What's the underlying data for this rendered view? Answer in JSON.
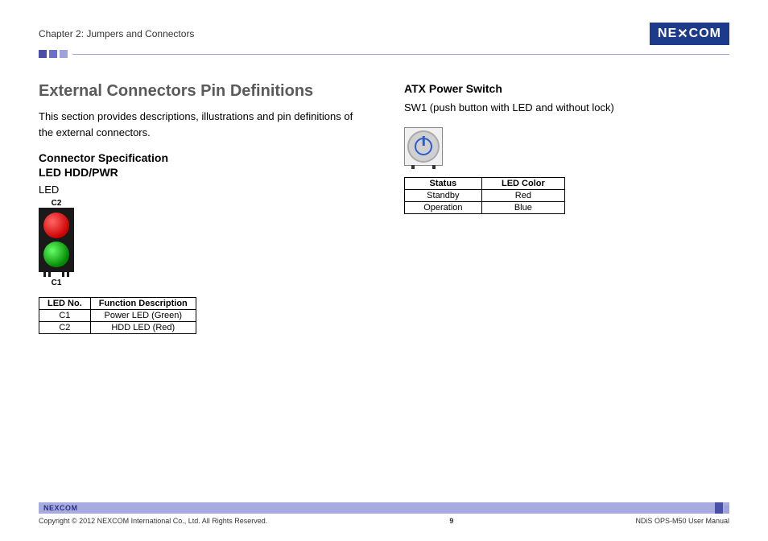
{
  "header": {
    "chapter": "Chapter 2: Jumpers and Connectors",
    "logo_text": "NEXCOM"
  },
  "left": {
    "title": "External Connectors Pin Definitions",
    "intro": "This section provides descriptions, illustrations and pin definitions of the external connectors.",
    "sub1": "Connector Specification",
    "sub2": "LED HDD/PWR",
    "led_label": "LED",
    "c2": "C2",
    "c1": "C1",
    "table_h1": "LED No.",
    "table_h2": "Function Description",
    "rows": [
      {
        "n": "C1",
        "d": "Power LED   (Green)"
      },
      {
        "n": "C2",
        "d": "HDD LED   (Red)"
      }
    ]
  },
  "right": {
    "title": "ATX Power Switch",
    "desc": "SW1 (push button with LED and without lock)",
    "table_h1": "Status",
    "table_h2": "LED Color",
    "rows": [
      {
        "s": "Standby",
        "c": "Red"
      },
      {
        "s": "Operation",
        "c": "Blue"
      }
    ]
  },
  "footer": {
    "logo": "NEXCOM",
    "copyright": "Copyright © 2012 NEXCOM International Co., Ltd. All Rights Reserved.",
    "page": "9",
    "doc": "NDiS OPS-M50 User Manual"
  }
}
